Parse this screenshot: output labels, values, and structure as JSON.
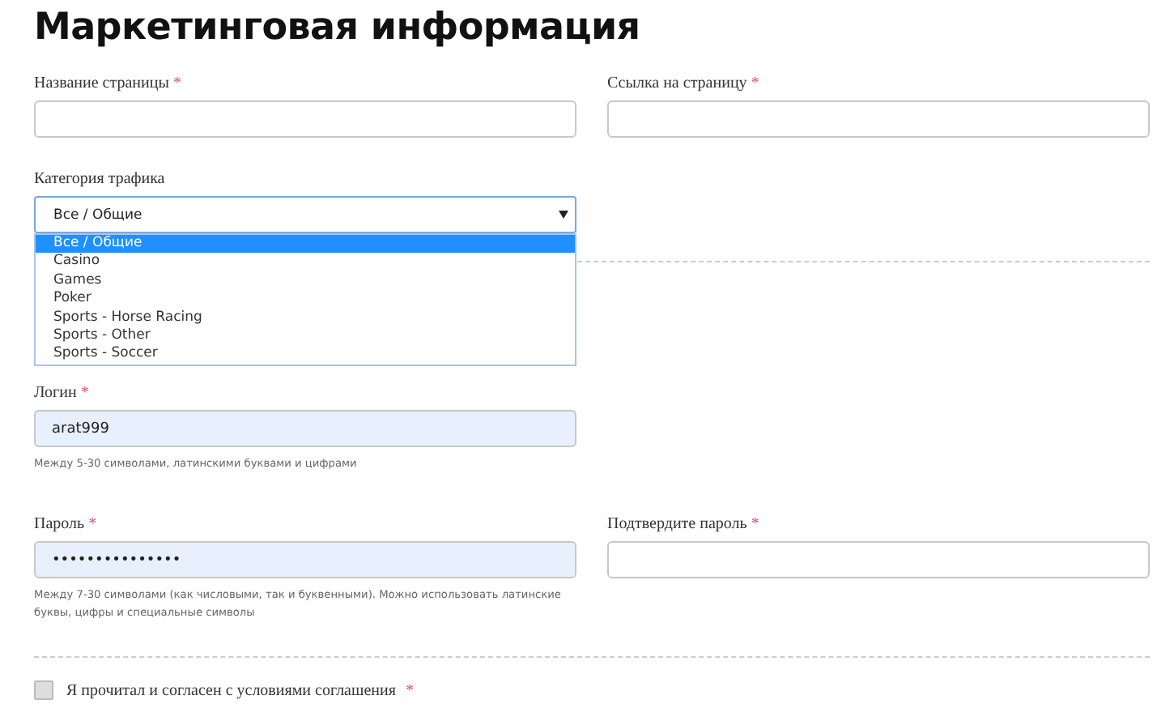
{
  "heading": "Маркетинговая информация",
  "page_fields": [
    {
      "label": "Название страницы",
      "required_mark": "*"
    },
    {
      "label": "Ссылка на страницу",
      "required_mark": "*"
    }
  ],
  "category": {
    "label": "Категория трафика",
    "value": "Все / Общие",
    "expanded": true,
    "options": [
      {
        "label": "Все / Общие",
        "selected": true
      },
      {
        "label": "Casino",
        "selected": false
      },
      {
        "label": "Games",
        "selected": false
      },
      {
        "label": "Poker",
        "selected": false
      },
      {
        "label": "Sports - Horse Racing",
        "selected": false
      },
      {
        "label": "Sports - Other",
        "selected": false
      },
      {
        "label": "Sports - Soccer",
        "selected": false
      }
    ]
  },
  "login": {
    "label": "Логин",
    "required_mark": "*",
    "value": "arat999",
    "autofilled": true,
    "hint": "Между 5-30 символами, латинскими буквами и цифрами"
  },
  "password": {
    "label": "Пароль",
    "required_mark": "*",
    "value": "•••••••••••••••",
    "autofilled": true,
    "hint": "Между 7-30 символами (как числовыми, так и буквенными). Можно использовать латинские буквы, цифры и специальные символы"
  },
  "confirm_password": {
    "label": "Подтвердите пароль",
    "required_mark": "*",
    "autofilled": false
  },
  "agreement": {
    "label": "Я прочитал и согласен с условиями соглашения",
    "required_mark": "*",
    "checked": false
  }
}
